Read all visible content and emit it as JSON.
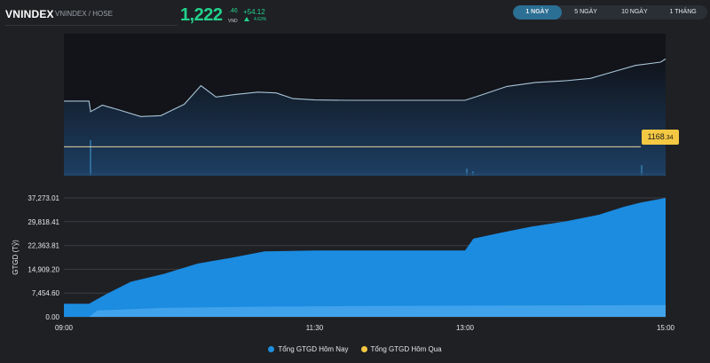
{
  "header": {
    "title": "VNINDEX",
    "subtitle": "VNINDEX / HOSE",
    "price_int": "1,222",
    "price_dec": ".46",
    "currency": "VND",
    "change": "+54.12",
    "change_pct": "4.63%"
  },
  "tabs": [
    "1 NGÀY",
    "5 NGÀY",
    "10 NGÀY",
    "1 THÁNG"
  ],
  "active_tab": 0,
  "colors": {
    "up": "#23d18b",
    "reference": "#f4c842",
    "today": "#1f8fe0",
    "yesterday": "#f4c842",
    "background": "#1f2024"
  },
  "reference": {
    "int": "1168",
    "dec": ".34"
  },
  "legend": [
    "Tổng GTGD Hôm Nay",
    "Tổng GTGD Hôm Qua"
  ],
  "chart_data": [
    {
      "type": "area",
      "series": [
        {
          "name": "VNINDEX",
          "time": [
            "09:00",
            "09:15",
            "09:16",
            "09:23",
            "09:33",
            "09:46",
            "09:58",
            "10:05",
            "10:12",
            "10:22",
            "10:31",
            "10:42",
            "10:56",
            "11:07",
            "11:17",
            "11:30",
            "11:50",
            "12:05",
            "13:00",
            "13:09",
            "13:25",
            "13:42",
            "14:00",
            "14:15",
            "14:30",
            "14:42",
            "14:57",
            "15:00"
          ],
          "values": [
            1196.5,
            1196.5,
            1190.0,
            1194.0,
            1191.0,
            1187.0,
            1187.5,
            1191.0,
            1194.5,
            1206.0,
            1199.0,
            1200.5,
            1202.0,
            1201.5,
            1198.0,
            1197.2,
            1197.0,
            1197.0,
            1197.0,
            1200.0,
            1205.5,
            1208.0,
            1209.0,
            1210.5,
            1215.0,
            1218.5,
            1220.5,
            1222.46
          ]
        }
      ],
      "reference_line": 1168.34,
      "ylim": [
        1150.5,
        1238
      ]
    },
    {
      "type": "area",
      "xlabel": "",
      "ylabel": "GTGD (Tỷ)",
      "y_ticks": [
        "37,273.01",
        "29,818.41",
        "22,363.81",
        "14,909.20",
        "7,454.60",
        "0.00"
      ],
      "x_ticks": [
        "09:00",
        "11:30",
        "13:00",
        "15:00"
      ],
      "ylim": [
        0,
        37273.01
      ],
      "series": [
        {
          "name": "Tổng GTGD Hôm Nay",
          "time": [
            "09:00",
            "09:15",
            "09:25",
            "09:40",
            "10:00",
            "10:20",
            "10:40",
            "11:00",
            "11:30",
            "12:00",
            "13:00",
            "13:05",
            "13:20",
            "13:40",
            "14:00",
            "14:20",
            "14:35",
            "14:45",
            "15:00"
          ],
          "values": [
            4100,
            4100,
            7000,
            11000,
            13500,
            16700,
            18500,
            20500,
            20800,
            20800,
            20800,
            24500,
            26200,
            28300,
            29900,
            32000,
            34500,
            35800,
            37273
          ]
        },
        {
          "name": "Tổng GTGD Hôm Qua",
          "time": [
            "09:00",
            "09:15",
            "09:20",
            "10:00",
            "11:00",
            "12:00",
            "13:00",
            "14:00",
            "15:00"
          ],
          "values": [
            0,
            0,
            2000,
            2800,
            3200,
            3400,
            3500,
            3600,
            3700
          ]
        }
      ]
    }
  ]
}
